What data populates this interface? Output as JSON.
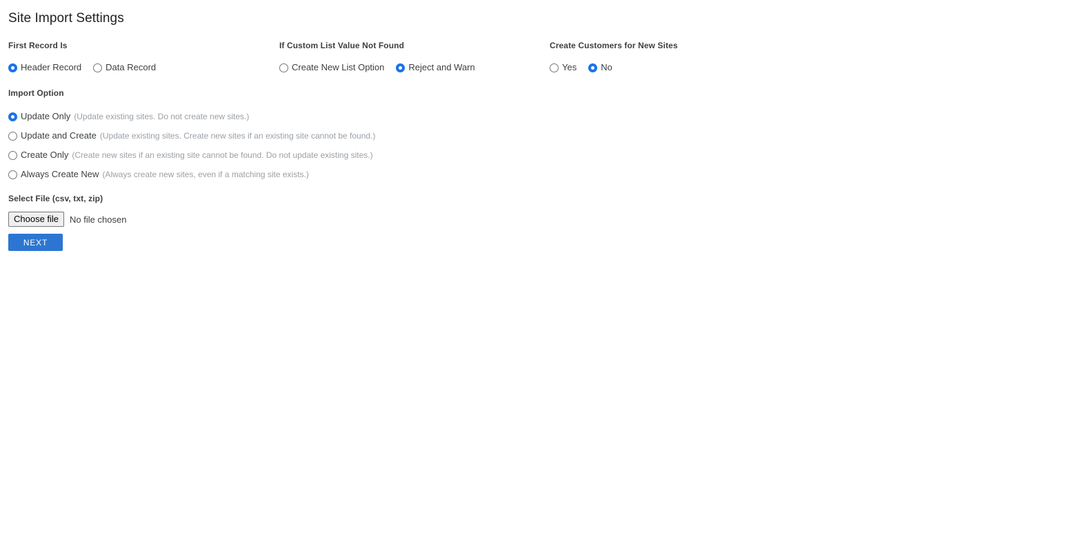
{
  "page": {
    "title": "Site Import Settings"
  },
  "first_record": {
    "label": "First Record Is",
    "options": [
      {
        "label": "Header Record",
        "selected": true
      },
      {
        "label": "Data Record",
        "selected": false
      }
    ]
  },
  "custom_list": {
    "label": "If Custom List Value Not Found",
    "options": [
      {
        "label": "Create New List Option",
        "selected": false
      },
      {
        "label": "Reject and Warn",
        "selected": true
      }
    ]
  },
  "create_customers": {
    "label": "Create Customers for New Sites",
    "options": [
      {
        "label": "Yes",
        "selected": false
      },
      {
        "label": "No",
        "selected": true
      }
    ]
  },
  "import_option": {
    "label": "Import Option",
    "options": [
      {
        "name": "Update Only",
        "description": "(Update existing sites. Do not create new sites.)",
        "selected": true
      },
      {
        "name": "Update and Create",
        "description": "(Update existing sites. Create new sites if an existing site cannot be found.)",
        "selected": false
      },
      {
        "name": "Create Only",
        "description": "(Create new sites if an existing site cannot be found. Do not update existing sites.)",
        "selected": false
      },
      {
        "name": "Always Create New",
        "description": "(Always create new sites, even if a matching site exists.)",
        "selected": false
      }
    ]
  },
  "select_file": {
    "label": "Select File (csv, txt, zip)",
    "button_label": "Choose file",
    "status": "No file chosen"
  },
  "actions": {
    "next_label": "NEXT"
  },
  "colors": {
    "accent_blue": "#1a73e8",
    "button_blue": "#2c76d2",
    "text": "#3c4043",
    "muted_text": "#9aa0a6",
    "title_text": "#202124"
  }
}
